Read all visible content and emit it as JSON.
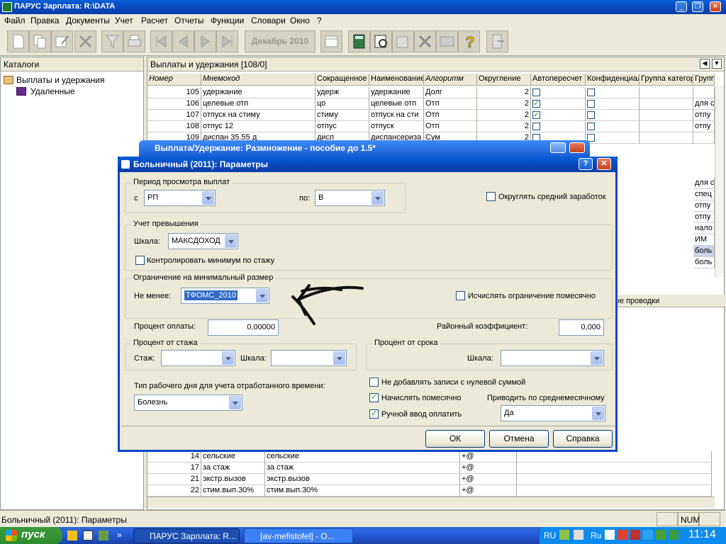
{
  "window": {
    "title": "ПАРУС Зарплата: R:\\DATA"
  },
  "menu": [
    "Файл",
    "Правка",
    "Документы",
    "Учет",
    "Расчет",
    "Отчеты",
    "Функции",
    "Словари",
    "Окно",
    "?"
  ],
  "toolbar": {
    "month": "Декабрь 2010"
  },
  "left_panel": {
    "title": "Каталоги",
    "items": [
      "Выплаты и удержания",
      "Удаленные"
    ]
  },
  "right_panel": {
    "title": "Выплаты и удержания [108/0]",
    "columns": [
      "Номер",
      "Мнемокод",
      "Сокращенное",
      "Наименование",
      "Алгоритм",
      "Округление",
      "Автопересчет",
      "Конфиденциал",
      "Группа категор",
      "Групп"
    ],
    "rows": [
      {
        "num": "105",
        "mnemo": "удержание",
        "short": "удерж",
        "name": "удержание",
        "algo": "Долг",
        "round": "2",
        "auto": false,
        "group2": ""
      },
      {
        "num": "106",
        "mnemo": "целевые отп",
        "short": "цо",
        "name": "целевые отп",
        "algo": "Отп",
        "round": "2",
        "auto": true,
        "group2": "для с"
      },
      {
        "num": "107",
        "mnemo": "отпуск на стиму",
        "short": "стиму",
        "name": "отпуск на сти",
        "algo": "Отп",
        "round": "2",
        "auto": true,
        "group2": "отпу"
      },
      {
        "num": "108",
        "mnemo": "отпус 12",
        "short": "отпус",
        "name": "отпуск",
        "algo": "Отп",
        "round": "2",
        "auto": false,
        "group2": "отпу"
      },
      {
        "num": "109",
        "mnemo": "диспан 35.55 д",
        "short": "дисп",
        "name": "диспансериза",
        "algo": "Сум",
        "round": "2",
        "auto": false,
        "group2": ""
      }
    ],
    "side_values": [
      "для с",
      "спец",
      "отпу",
      "отпу",
      "нало",
      "ИМ",
      "боль",
      "боль"
    ],
    "lower_tab": "ые проводки",
    "lower_rows": [
      {
        "num": "14",
        "a": "сельские",
        "b": "сельские",
        "c": "+@"
      },
      {
        "num": "17",
        "a": "за стаж",
        "b": "за стаж",
        "c": "+@"
      },
      {
        "num": "21",
        "a": "экстр.вызов",
        "b": "экстр.вызов",
        "c": "+@"
      },
      {
        "num": "22",
        "a": "стим.вып.30%",
        "b": "стим.вып.30%",
        "c": "+@"
      }
    ]
  },
  "bg_dialog": {
    "title": "Выплата/Удержание: Размножение - пособие до 1.5*"
  },
  "dialog": {
    "title": "Больничный (2011): Параметры",
    "period": {
      "group": "Период просмотра выплат",
      "from_label": "с",
      "from_value": "РП",
      "to_label": "по:",
      "to_value": "В"
    },
    "round_avg": {
      "label": "Округлять средний заработок",
      "checked": false
    },
    "excess": {
      "group": "Учет превышения",
      "scale_label": "Шкала:",
      "scale_value": "МАКСДОХОД",
      "min_stage_label": "Контролировать минимум по стажу"
    },
    "min_limit": {
      "group": "Ограничение на минимальный размер",
      "not_less_label": "Не менее:",
      "not_less_value": "ТФОМС_2010",
      "monthly_label": "Исчислять ограничение помесячно"
    },
    "pay_percent": {
      "label": "Процент оплаты:",
      "value": "0,00000"
    },
    "regional": {
      "label": "Районный коэффициент:",
      "value": "0,000"
    },
    "stage_percent": {
      "group": "Процент от стажа",
      "stage_label": "Стаж:",
      "scale_label": "Шкала:"
    },
    "term_percent": {
      "group": "Процент от срока",
      "scale_label": "Шкала:"
    },
    "workday": {
      "label": "Тип рабочего дня для учета отработанного времени:",
      "value": "Болезнь"
    },
    "no_zero": {
      "label": "Не добавлять записи с нулевой суммой",
      "checked": false
    },
    "monthly": {
      "label": "Начислять помесячно",
      "checked": true
    },
    "manual": {
      "label": "Ручной ввод оплатить",
      "checked": true
    },
    "avg_month": {
      "label": "Приводить по среднемесячному",
      "value": "Да"
    },
    "buttons": {
      "ok": "ОК",
      "cancel": "Отмена",
      "help": "Справка"
    }
  },
  "status": {
    "text": "Больничный (2011): Параметры",
    "num": "NUM"
  },
  "taskbar": {
    "start": "пуск",
    "tasks": [
      "ПАРУС Зарплата: R...",
      "[av-mefistofel] - О..."
    ],
    "lang1": "RU",
    "lang2": "Ru",
    "time": "11:14"
  }
}
